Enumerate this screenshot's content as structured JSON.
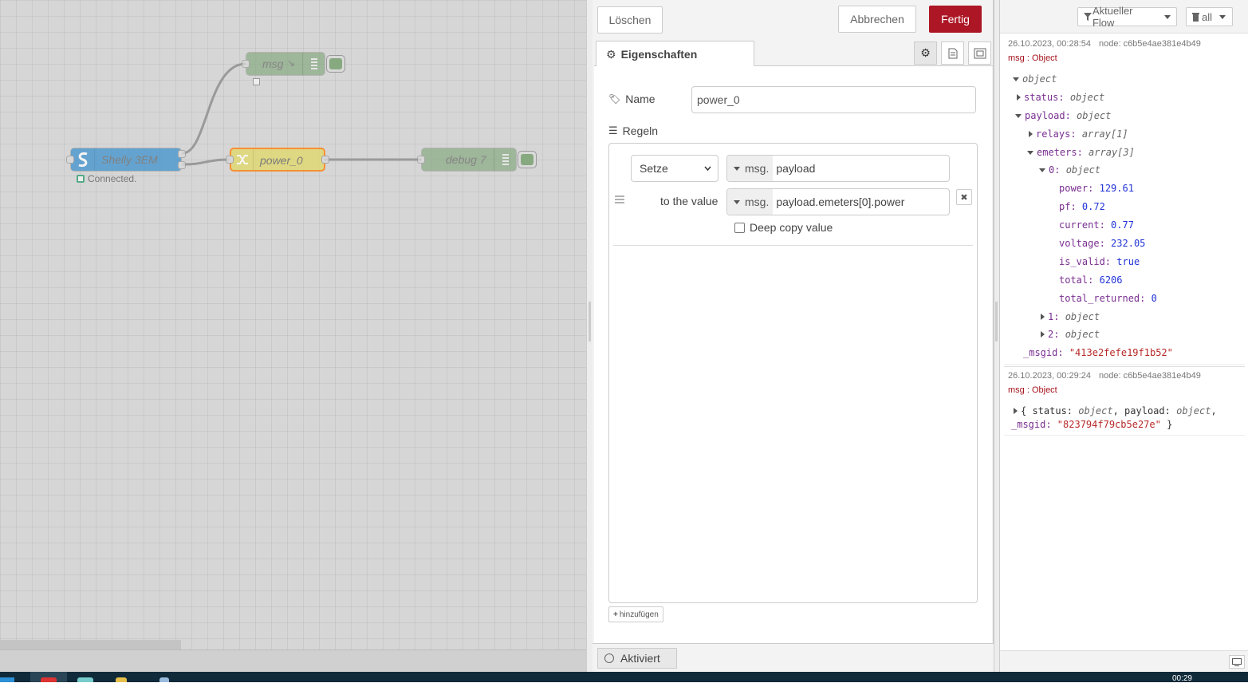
{
  "workspace": {
    "nodes": {
      "msg": "msg",
      "shelly": "Shelly 3EM",
      "shelly_status": "Connected.",
      "change": "power_0",
      "debug": "debug 7"
    }
  },
  "tray": {
    "delete_label": "Löschen",
    "cancel_label": "Abbrechen",
    "done_label": "Fertig",
    "tab_properties": "Eigenschaften",
    "name_label": "Name",
    "name_value": "power_0",
    "rules_label": "Regeln",
    "rule": {
      "action": "Setze",
      "action_options": [
        "Setze"
      ],
      "target_type": "msg.",
      "target_value": "payload",
      "to_label": "to the value",
      "source_type": "msg.",
      "source_value": "payload.emeters[0].power",
      "deep_copy_label": "Deep copy value",
      "deep_copy_checked": false
    },
    "add_label": "hinzufügen",
    "enabled_label": "Aktiviert"
  },
  "sidebar": {
    "filter_label": "Aktueller Flow",
    "clear_label": "all",
    "messages": [
      {
        "timestamp": "26.10.2023, 00:28:54",
        "node": "node: c6b5e4ae381e4b49",
        "topic": "msg : Object",
        "tree": {
          "root": "object",
          "status_key": "status",
          "status_type": "object",
          "payload_key": "payload",
          "payload_type": "object",
          "relays_key": "relays",
          "relays_type": "array[1]",
          "emeters_key": "emeters",
          "emeters_type": "array[3]",
          "item0_key": "0",
          "item0_type": "object",
          "power_key": "power",
          "power": "129.61",
          "pf_key": "pf",
          "pf": "0.72",
          "current_key": "current",
          "current": "0.77",
          "voltage_key": "voltage",
          "voltage": "232.05",
          "is_valid_key": "is_valid",
          "is_valid": "true",
          "total_key": "total",
          "total": "6206",
          "total_returned_key": "total_returned",
          "total_returned": "0",
          "item1_key": "1",
          "item1_type": "object",
          "item2_key": "2",
          "item2_type": "object",
          "msgid_key": "_msgid",
          "msgid": "\"413e2fefe19f1b52\""
        }
      },
      {
        "timestamp": "26.10.2023, 00:29:24",
        "node": "node: c6b5e4ae381e4b49",
        "topic": "msg : Object",
        "summary_line1_a": "{ status: ",
        "summary_line1_b": "object",
        "summary_line1_c": ", payload: ",
        "summary_line1_d": "object",
        "summary_line1_e": ",",
        "summary_line2_key": "_msgid: ",
        "summary_line2_val": "\"823794f79cb5e27e\"",
        "summary_line2_end": " }"
      }
    ]
  },
  "taskbar": {
    "clock": "00:29"
  }
}
